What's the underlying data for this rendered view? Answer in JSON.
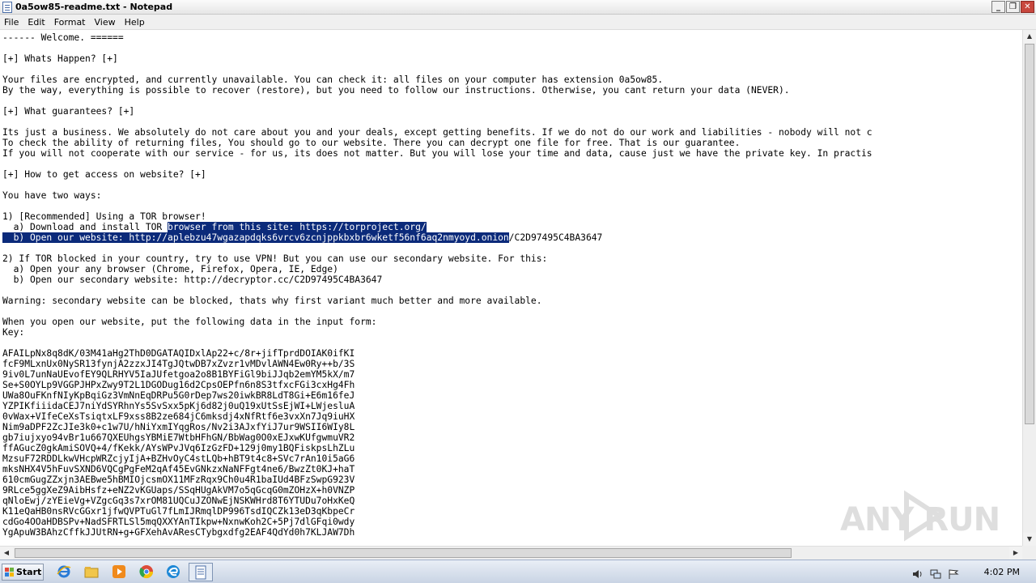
{
  "window": {
    "title": "0a5ow85-readme.txt - Notepad",
    "buttons": {
      "minimize": "_",
      "maximize": "❐",
      "close": "✕"
    }
  },
  "menu": [
    "File",
    "Edit",
    "Format",
    "View",
    "Help"
  ],
  "document": {
    "lines": [
      "------ Welcome. ======",
      "",
      "[+] Whats Happen? [+]",
      "",
      "Your files are encrypted, and currently unavailable. You can check it: all files on your computer has extension 0a5ow85.",
      "By the way, everything is possible to recover (restore), but you need to follow our instructions. Otherwise, you cant return your data (NEVER).",
      "",
      "[+] What guarantees? [+]",
      "",
      "Its just a business. We absolutely do not care about you and your deals, except getting benefits. If we do not do our work and liabilities - nobody will not c",
      "To check the ability of returning files, You should go to our website. There you can decrypt one file for free. That is our guarantee.",
      "If you will not cooperate with our service - for us, its does not matter. But you will lose your time and data, cause just we have the private key. In practis",
      "",
      "[+] How to get access on website? [+]",
      "",
      "You have two ways:",
      "",
      "1) [Recommended] Using a TOR browser!",
      "  a) Download and install TOR browser from this site: https://torproject.org/",
      "  b) Open our website: http://aplebzu47wgazapdqks6vrcv6zcnjppkbxbr6wketf56nf6aq2nmyoyd.onion/C2D97495C4BA3647",
      "",
      "2) If TOR blocked in your country, try to use VPN! But you can use our secondary website. For this:",
      "  a) Open your any browser (Chrome, Firefox, Opera, IE, Edge)",
      "  b) Open our secondary website: http://decryptor.cc/C2D97495C4BA3647",
      "",
      "Warning: secondary website can be blocked, thats why first variant much better and more available.",
      "",
      "When you open our website, put the following data in the input form:",
      "Key:",
      "",
      "AFAILpNx8q8dK/03M41aHg2ThD0DGATAQIDxlAp22+c/8r+jifTprdDOIAK0ifKI",
      "fcF9MLxnUx0NySR13fynjA2zzxJI4TgJQtwDB7xZvzr1vMDvlAWN4Ew0Ry++b/3S",
      "9iv0L7unNaUEvofEY9QLRHYV5IaJUfetgoa2o8B1BYFiGl9biJJqb2emYM5kX/m7",
      "Se+S0OYLp9VGGPJHPxZwy9T2L1DGODug16d2CpsOEPfn6n8S3tfxcFGi3cxHg4Fh",
      "UWa8OuFKnfNIyKpBqiGz3VmNnEqDRPu5G0rDep7ws20iwkBR8LdT8Gi+E6m16feJ",
      "YZPIKfiiidaCEJ7niYdSYRhnYs5SvSxx5pKj6d82j0uQ19xUtSsEjWI+LWjesluA",
      "0vWax+VIfeCeXsTsiqtxLF9xss8B2ze684jC6mksdj4xNfRtf6e3vxXn7Jq9iuHX",
      "Nim9aDPF2ZcJIe3k0+c1w7U/hNiYxmIYqgRos/Nv2i3AJxfYiJ7ur9WSII6WIy8L",
      "gb7iujxyo94vBr1u667QXEUhgsYBMiE7WtbHFhGN/BbWag0O0xEJxwKUfgwmuVR2",
      "ffAGucZ0gkAmiSOVQ+4/fKekk/AYsWPvJVq6IzGzFD+129j0my1BQFiskpsLhZLu",
      "MzsuF72RDDLkwVHcpWRZcjyIjA+BZHvOyC4stLQb+hBT9t4c8+SVc7rAn10i5aG6",
      "mksNHX4V5hFuvSXND6VQCgPgFeM2qAf45EvGNkzxNaNFFgt4ne6/BwzZt0KJ+haT",
      "610cmGugZZxjn3AEBwe5hBMIOjcsmOX11MFzRqx9Ch0u4R1baIUd4BFzSwpG923V",
      "9RLce5ggXeZ9AibHsfz+eNZ2vKGUaps/SSqHUgAkVM7o5qGcqG0mZOHzX+h0VNZP",
      "qNloEwj/zYEieVg+VZgcGq3s7xrOM81UQCuJZONwEjNSKWHrd8T6YTUDu7oHxKeQ",
      "K11eQaHB0nsRVcGGxr1jfwQVPTuGl7fLmIJRmqlDP996TsdIQCZk13eD3qKbpeCr",
      "cdGo4OOaHDBSPv+NadSFRTLSl5mqQXXYAnTIkpw+NxnwKoh2C+5Pj7dlGFqi0wdy",
      "YgApuW3BAhzCffkJJUtRN+g+GFXehAvAResCTybgxdfg2EAF4QdYd0h7KLJAW7Dh"
    ],
    "selection": {
      "line18_before": "  a) Download and install TOR ",
      "line18_selected": "browser from this site: https://torproject.org/",
      "line19_selected": "  b) Open our website: http://aplebzu47wgazapdqks6vrcv6zcnjppkbxbr6wketf56nf6aq2nmyoyd.onion",
      "line19_after": "/C2D97495C4BA3647"
    }
  },
  "taskbar": {
    "start_label": "Start",
    "pinned": [
      "ie-icon",
      "explorer-icon",
      "media-player-icon",
      "chrome-icon",
      "edge-icon",
      "notepad-icon"
    ],
    "clock": "4:02 PM"
  },
  "watermark": {
    "text": "ANY RUN"
  },
  "colors": {
    "selection": "#0b2a7a",
    "taskbar": "#d6deea",
    "text": "#000000"
  }
}
